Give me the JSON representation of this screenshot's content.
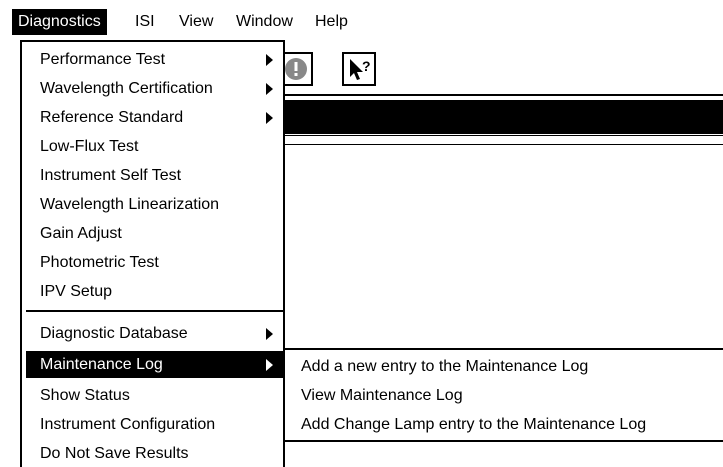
{
  "menubar": {
    "items": [
      {
        "label": "Diagnostics",
        "active": true
      },
      {
        "label": "ISI"
      },
      {
        "label": "View"
      },
      {
        "label": "Window"
      },
      {
        "label": "Help"
      }
    ]
  },
  "toolbar": {
    "buttons": [
      {
        "icon": "stop-icon"
      },
      {
        "icon": "context-help-icon"
      }
    ]
  },
  "diagnostics_menu": {
    "items": [
      {
        "label": "Performance Test",
        "submenu": true
      },
      {
        "label": "Wavelength Certification",
        "submenu": true
      },
      {
        "label": "Reference Standard",
        "submenu": true
      },
      {
        "label": "Low-Flux Test"
      },
      {
        "label": "Instrument Self Test"
      },
      {
        "label": "Wavelength Linearization"
      },
      {
        "label": "Gain Adjust"
      },
      {
        "label": "Photometric Test"
      },
      {
        "label": "IPV Setup"
      },
      {
        "label": "Diagnostic Database",
        "submenu": true
      },
      {
        "label": "Maintenance Log",
        "submenu": true,
        "selected": true
      },
      {
        "label": "Show Status"
      },
      {
        "label": "Instrument Configuration"
      },
      {
        "label": "Do Not Save Results"
      }
    ]
  },
  "maintenance_submenu": {
    "items": [
      {
        "label": "Add a new entry to the Maintenance Log"
      },
      {
        "label": "View Maintenance Log"
      },
      {
        "label": "Add Change Lamp entry to the Maintenance Log"
      }
    ]
  }
}
